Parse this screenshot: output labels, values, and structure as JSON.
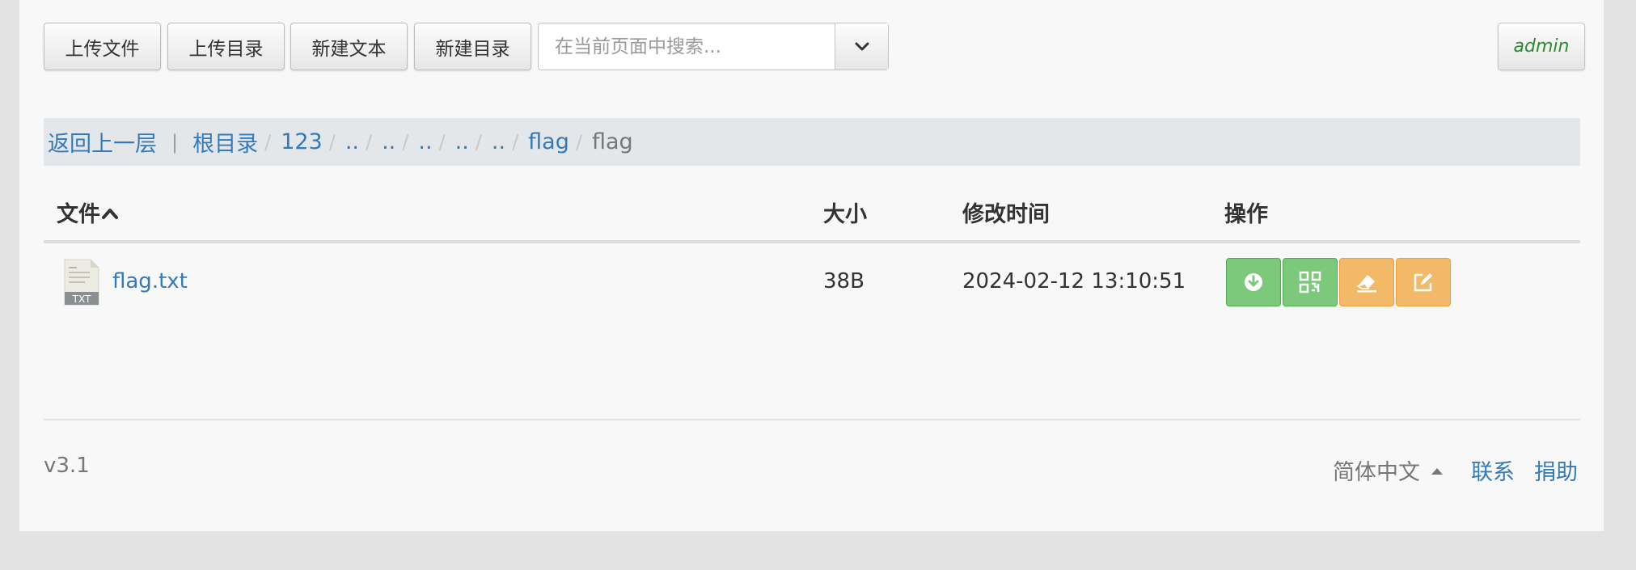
{
  "toolbar": {
    "upload_file": "上传文件",
    "upload_dir": "上传目录",
    "new_text": "新建文本",
    "new_dir": "新建目录",
    "search_placeholder": "在当前页面中搜索...",
    "user": "admin"
  },
  "breadcrumb": {
    "back": "返回上一层",
    "root": "根目录",
    "items": [
      "123",
      "..",
      "..",
      "..",
      "..",
      "..",
      "flag"
    ],
    "current": "flag"
  },
  "table": {
    "headers": {
      "name": "文件",
      "size": "大小",
      "mtime": "修改时间",
      "actions": "操作"
    },
    "rows": [
      {
        "icon_label": "TXT",
        "name": "flag.txt",
        "size": "38B",
        "mtime": "2024-02-12 13:10:51"
      }
    ]
  },
  "icons": {
    "sort": "caret-up-icon",
    "file": "txt-file-icon",
    "actions": [
      "download-icon",
      "qrcode-icon",
      "eraser-icon",
      "edit-icon"
    ]
  },
  "colors": {
    "link": "#337ab7",
    "success": "#7cc97c",
    "warning": "#f2b968",
    "user": "#2d8a2d"
  },
  "footer": {
    "version": "v3.1",
    "language": "简体中文",
    "contact": "联系",
    "donate": "捐助"
  }
}
